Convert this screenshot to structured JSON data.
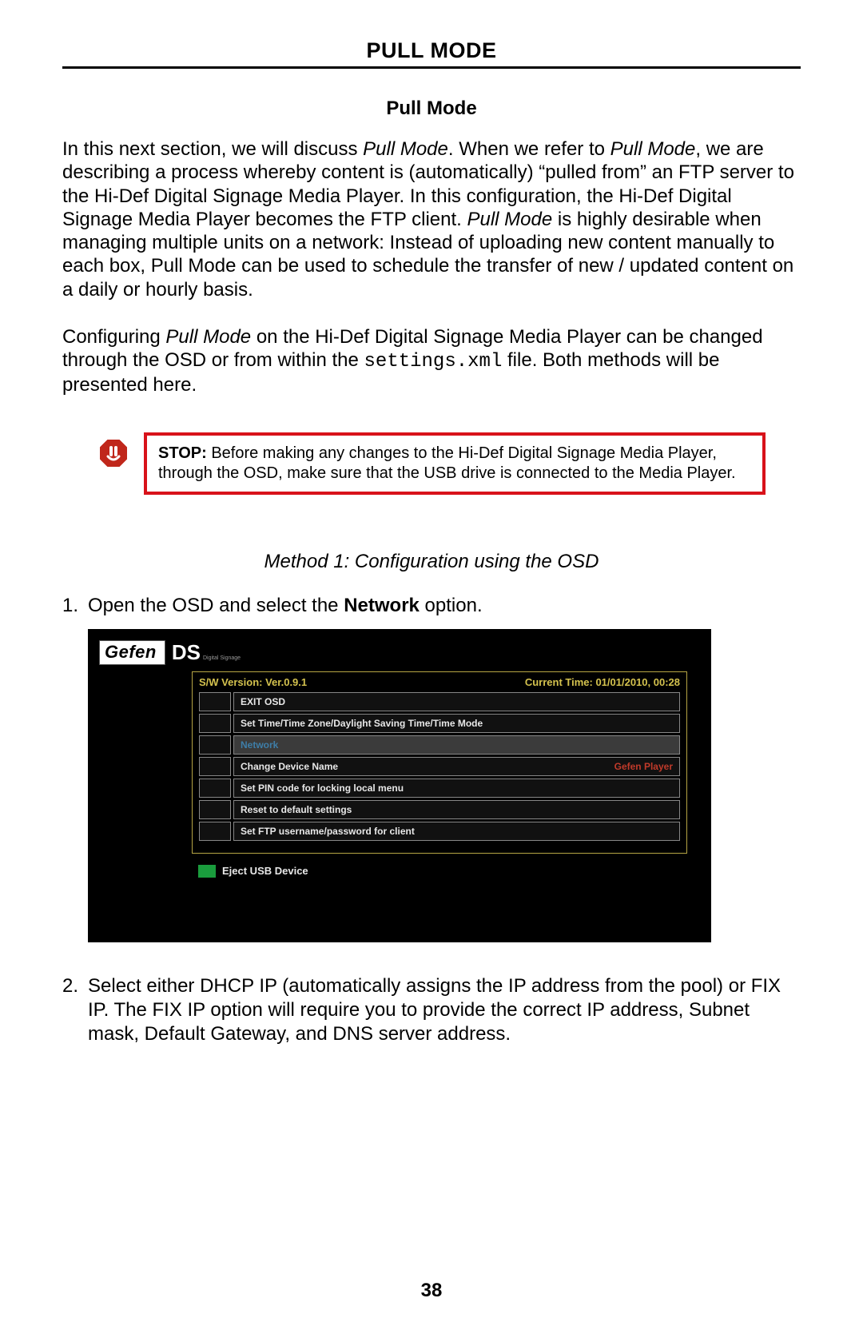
{
  "page_title": "PULL MODE",
  "section_title": "Pull Mode",
  "para1_parts": [
    {
      "t": "In this next section, we will discuss "
    },
    {
      "t": "Pull Mode",
      "italic": true
    },
    {
      "t": ".  When we refer to "
    },
    {
      "t": "Pull Mode",
      "italic": true
    },
    {
      "t": ", we are describing a process whereby content is (automatically) “pulled from” an FTP server to the Hi-Def Digital Signage Media Player.  In this configuration, the Hi-Def Digital Signage Media Player becomes the FTP client.  "
    },
    {
      "t": "Pull Mode",
      "italic": true
    },
    {
      "t": " is highly desirable when managing multiple units on a network:  Instead of uploading new content manually to each box, Pull Mode can be used to schedule the transfer of new / updated content on a daily or hourly basis."
    }
  ],
  "para2_pre": "Configuring ",
  "para2_pm": "Pull Mode",
  "para2_mid": " on the Hi-Def Digital Signage Media Player can be changed through the OSD or from within the ",
  "para2_code": "settings.xml",
  "para2_post": " file.  Both methods will be presented here.",
  "stop": {
    "label": "STOP:",
    "text": " Before making any changes to the Hi-Def Digital Signage Media Player, through the OSD, make sure that the USB drive is connected to the Media Player."
  },
  "method_title": "Method 1: Configuration using the OSD",
  "step1": {
    "num": "1.",
    "pre": "Open the OSD and select the ",
    "bold": "Network",
    "post": " option."
  },
  "osd": {
    "logo_main": "Gefen",
    "logo_ds": "DS",
    "logo_sub": "Digital Signage",
    "version": "S/W Version: Ver.0.9.1",
    "time": "Current Time: 01/01/2010, 00:28",
    "rows": [
      {
        "label": "EXIT OSD",
        "value": ""
      },
      {
        "label": "Set Time/Time Zone/Daylight Saving Time/Time Mode",
        "value": ""
      },
      {
        "label": "Network",
        "value": "",
        "selected": true
      },
      {
        "label": "Change Device Name",
        "value": "Gefen Player",
        "value_red": true
      },
      {
        "label": "Set PIN code for locking local menu",
        "value": ""
      },
      {
        "label": "Reset to default settings",
        "value": ""
      },
      {
        "label": "Set FTP username/password for client",
        "value": ""
      }
    ],
    "eject": "Eject USB Device"
  },
  "step2": {
    "num": "2.",
    "text": "Select either DHCP IP (automatically assigns the IP address from the pool) or FIX IP.  The FIX IP option will require you to provide the correct IP address, Subnet mask, Default Gateway, and DNS server address."
  },
  "page_number": "38"
}
